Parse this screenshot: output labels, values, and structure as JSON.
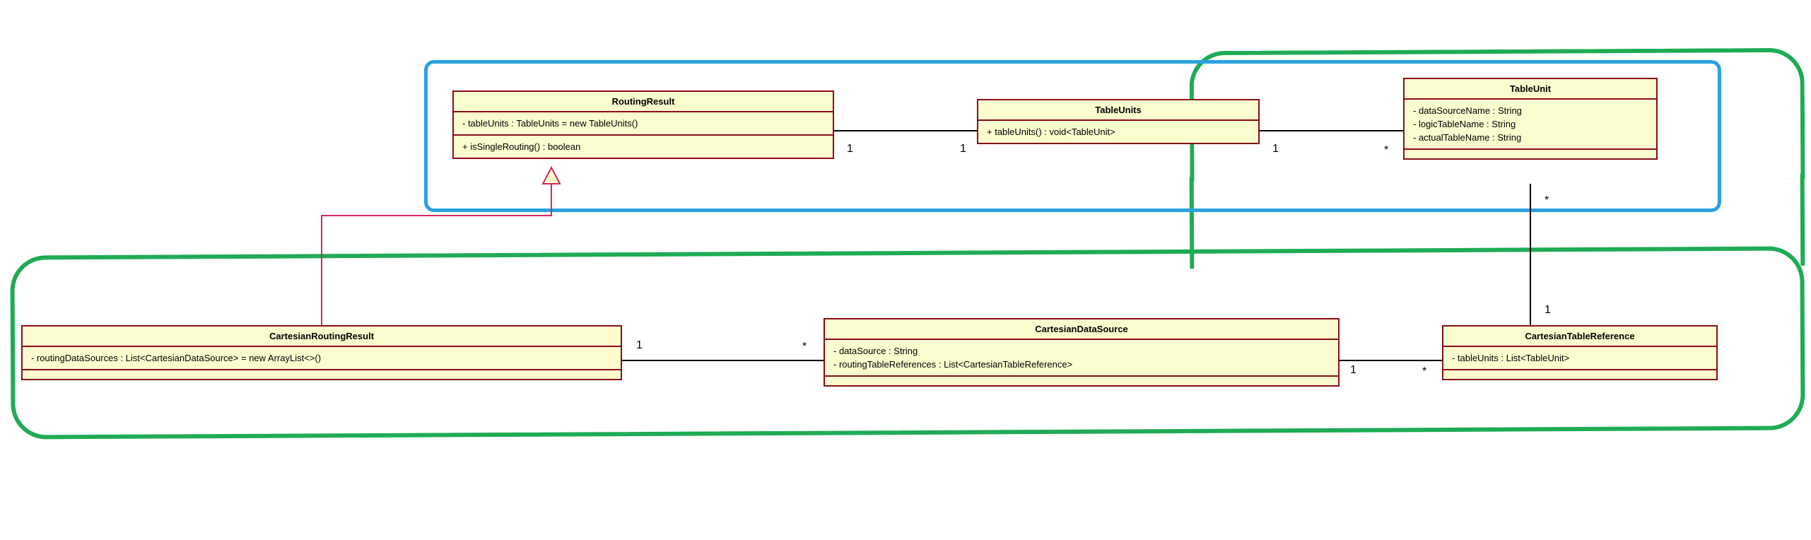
{
  "classes": {
    "routingResult": {
      "name": "RoutingResult",
      "attrs": [
        "- tableUnits : TableUnits = new TableUnits()"
      ],
      "ops": [
        "+ isSingleRouting() : boolean"
      ]
    },
    "tableUnits": {
      "name": "TableUnits",
      "attrs": [],
      "ops": [
        "+ tableUnits() : void<TableUnit>"
      ]
    },
    "tableUnit": {
      "name": "TableUnit",
      "attrs": [
        "- dataSourceName : String",
        "- logicTableName : String",
        "- actualTableName : String"
      ],
      "ops": []
    },
    "cartesianRoutingResult": {
      "name": "CartesianRoutingResult",
      "attrs": [
        "- routingDataSources : List<CartesianDataSource> = new ArrayList<>()"
      ],
      "ops": []
    },
    "cartesianDataSource": {
      "name": "CartesianDataSource",
      "attrs": [
        "- dataSource : String",
        "- routingTableReferences : List<CartesianTableReference>"
      ],
      "ops": []
    },
    "cartesianTableReference": {
      "name": "CartesianTableReference",
      "attrs": [
        "- tableUnits : List<TableUnit>"
      ],
      "ops": []
    }
  },
  "multiplicities": {
    "rr_tu_left": "1",
    "rr_tu_right": "1",
    "tu_tuu_left": "1",
    "tu_tuu_right": "*",
    "tuu_ctr_top": "*",
    "tuu_ctr_bottom": "1",
    "crr_cds_left": "1",
    "crr_cds_right": "*",
    "cds_ctr_left": "1",
    "cds_ctr_right": "*"
  }
}
